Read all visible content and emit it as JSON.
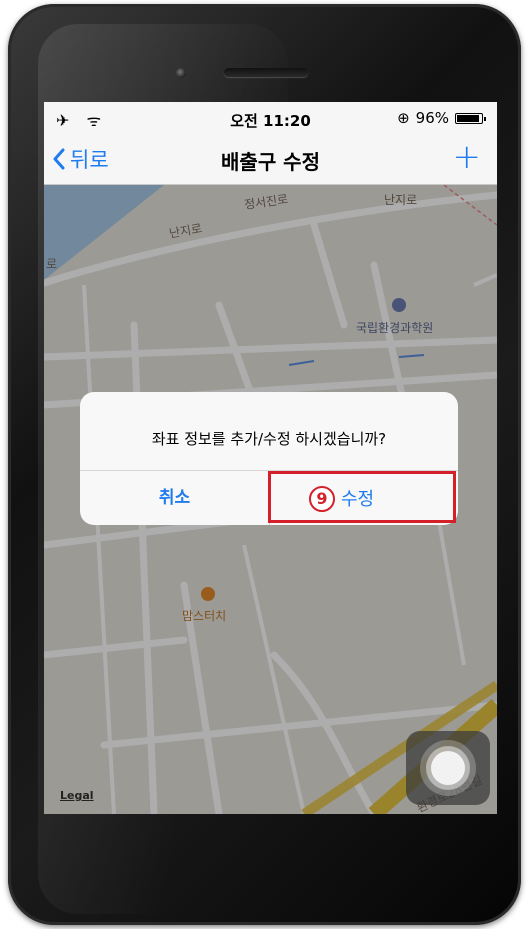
{
  "status_bar": {
    "left_icons": "✈ ᯤ",
    "time": "오전 11:20",
    "lock_icon": "⊕",
    "battery_text": "96%",
    "battery_level": 0.96
  },
  "nav": {
    "back_label": "뒤로",
    "title": "배출구 수정",
    "add_glyph": "+"
  },
  "map": {
    "labels": [
      "정서진로",
      "난지로",
      "난지로",
      "로"
    ],
    "poi_1": "국립환경과학원",
    "poi_2": "맘스터치",
    "road_label": "환경로28번길",
    "legal": "Legal"
  },
  "alert": {
    "message": "좌표 정보를 추가/수정 하시겠습니까?",
    "cancel_label": "취소",
    "confirm_label": "수정",
    "step_number": "9"
  },
  "colors": {
    "accent": "#1e7bf0",
    "highlight": "#d4202a"
  }
}
